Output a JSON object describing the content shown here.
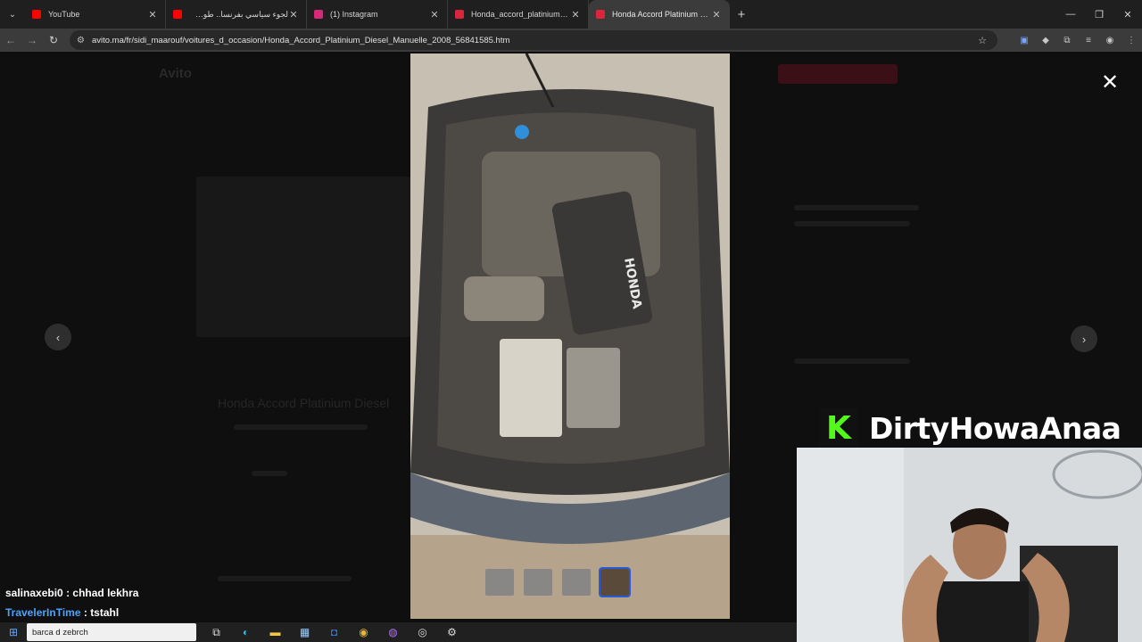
{
  "browser": {
    "tabs": [
      {
        "title": "YouTube",
        "color": "#ff0000",
        "active": false
      },
      {
        "title": "لجوء سياسي بفرنسا.. طوطو يعلن",
        "color": "#ff0000",
        "active": false
      },
      {
        "title": "(1) Instagram",
        "color": "#d62976",
        "active": false
      },
      {
        "title": "Honda_accord_platinium : Déc",
        "color": "#d8263a",
        "active": false
      },
      {
        "title": "Honda Accord Platinium Diese",
        "color": "#d8263a",
        "active": true
      }
    ],
    "url": "avito.ma/fr/sidi_maarouf/voitures_d_occasion/Honda_Accord_Platinium_Diesel_Manuelle_2008_56841585.htm"
  },
  "viewer": {
    "close_symbol": "✕",
    "prev_symbol": "‹",
    "next_symbol": "›",
    "thumbnail_count": 4,
    "active_thumbnail": 4,
    "image_text": "HONDA"
  },
  "background_page": {
    "logo": "Avito",
    "title": "Honda Accord Platinium Diesel"
  },
  "stream_overlay": {
    "channel_name": "DirtyHowaAnaa",
    "logo_letter": "K",
    "logo_color": "#53fc18"
  },
  "chat": [
    {
      "user": "salinaxebi0",
      "message": "chhad lekhra"
    },
    {
      "user": "TravelerInTime",
      "message": "tstahl"
    }
  ],
  "taskbar": {
    "search_text": "barca d zebrch"
  }
}
